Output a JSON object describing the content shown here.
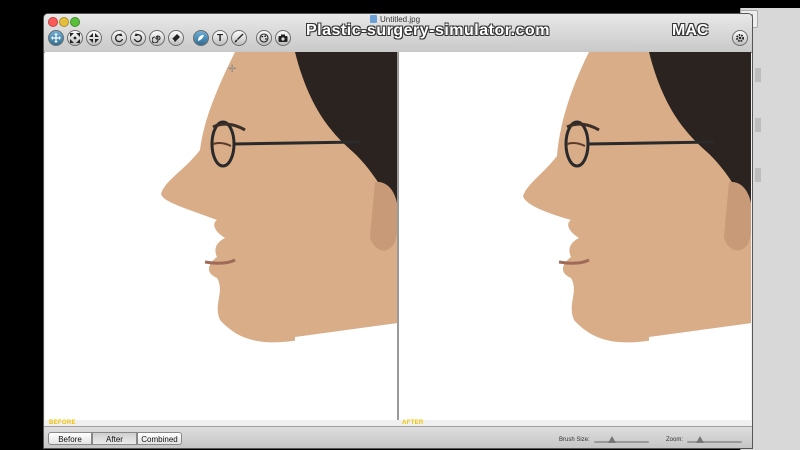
{
  "window": {
    "title": "Untitled.jpg",
    "watermark": "Plastic-surgery-simulator.com",
    "platform_badge": "MAC"
  },
  "toolbar": {
    "tools": [
      {
        "icon": "move-tool-icon"
      },
      {
        "icon": "expand-tool-icon"
      },
      {
        "icon": "shrink-tool-icon"
      },
      {
        "icon": "rotate-left-icon"
      },
      {
        "icon": "rotate-right-icon"
      },
      {
        "icon": "twirl-icon"
      },
      {
        "icon": "eraser-icon"
      },
      {
        "icon": "smudge-tool-icon"
      },
      {
        "icon": "text-tool-icon",
        "glyph": "T"
      },
      {
        "icon": "brush-tool-icon"
      },
      {
        "icon": "palette-icon"
      },
      {
        "icon": "camera-icon"
      }
    ],
    "settings_icon": "settings-icon"
  },
  "panes": {
    "before_label": "BEFORE",
    "after_label": "AFTER"
  },
  "view_mode": {
    "options": [
      "Before",
      "After",
      "Combined"
    ],
    "selected": "After"
  },
  "sliders": {
    "brush_size_label": "Brush Size:",
    "zoom_label": "Zoom:"
  },
  "colors": {
    "pane_label": "#f2c200",
    "active_tool": "#2f6f96"
  }
}
